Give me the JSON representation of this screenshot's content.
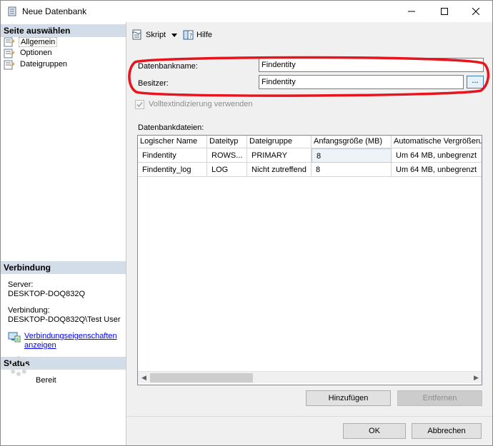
{
  "window": {
    "title": "Neue Datenbank"
  },
  "left": {
    "select_page_header": "Seite auswählen",
    "pages": [
      {
        "label": "Allgemein",
        "selected": true
      },
      {
        "label": "Optionen",
        "selected": false
      },
      {
        "label": "Dateigruppen",
        "selected": false
      }
    ],
    "connection_header": "Verbindung",
    "server_label": "Server:",
    "server_value": "DESKTOP-DOQ832Q",
    "connection_label": "Verbindung:",
    "connection_value": "DESKTOP-DOQ832Q\\Test User",
    "link_line1": "Verbindungseigenschaften",
    "link_line2": "anzeigen",
    "status_header": "Status",
    "status_value": "Bereit"
  },
  "toolbar": {
    "script_label": "Skript",
    "help_label": "Hilfe"
  },
  "form": {
    "dbname_label": "Datenbankname:",
    "dbname_value": "Findentity",
    "owner_label": "Besitzer:",
    "owner_value": "Findentity",
    "browse_label": "...",
    "fulltext_label": "Volltextindizierung verwenden",
    "files_label": "Datenbankdateien:"
  },
  "files_table": {
    "columns": [
      "Logischer Name",
      "Dateityp",
      "Dateigruppe",
      "Anfangsgröße (MB)",
      "Automatische Vergrößerun"
    ],
    "rows": [
      [
        "Findentity",
        "ROWS...",
        "PRIMARY",
        "8",
        "Um 64 MB, unbegrenzt"
      ],
      [
        "Findentity_log",
        "LOG",
        "Nicht zutreffend",
        "8",
        "Um 64 MB, unbegrenzt"
      ]
    ]
  },
  "buttons": {
    "add": "Hinzufügen",
    "remove": "Entfernen",
    "ok": "OK",
    "cancel": "Abbrechen"
  },
  "colors": {
    "highlight_ring": "#e8141d",
    "section_header": "#d3dce9",
    "link": "#0000ee"
  }
}
